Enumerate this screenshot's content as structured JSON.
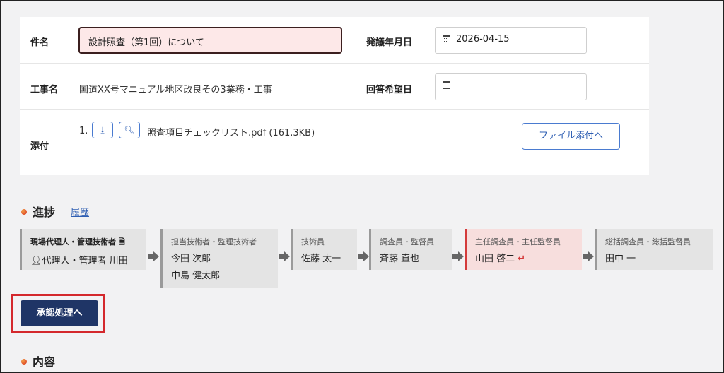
{
  "form": {
    "subject_label": "件名",
    "subject_value": "設計照査（第1回）について",
    "issue_date_label": "発議年月日",
    "issue_date_value": "2026-04-15",
    "project_label": "工事名",
    "project_value": "国道XX号マニュアル地区改良その3業務・工事",
    "reply_date_label": "回答希望日",
    "reply_date_value": "",
    "attachment_label": "添付",
    "attachment_index": "1.",
    "attachment_file": "照査項目チェックリスト.pdf (161.3KB)",
    "attach_button_label": "ファイル添付へ"
  },
  "progress": {
    "title": "進捗",
    "history_link": "履歴",
    "steps": [
      {
        "role": "現場代理人・管理技術者",
        "names": [
          "代理人・管理者 川田"
        ],
        "active": false
      },
      {
        "role": "担当技術者・監理技術者",
        "names": [
          "今田 次郎",
          "中島 健太郎"
        ],
        "active": false
      },
      {
        "role": "技術員",
        "names": [
          "佐藤 太一"
        ],
        "active": false
      },
      {
        "role": "調査員・監督員",
        "names": [
          "斉藤 直也"
        ],
        "active": false
      },
      {
        "role": "主任調査員・主任監督員",
        "names": [
          "山田 啓二"
        ],
        "active": true
      },
      {
        "role": "総括調査員・総括監督員",
        "names": [
          "田中 一"
        ],
        "active": false
      }
    ],
    "return_icon": "return-arrow-icon",
    "active_color": "#d43b3b"
  },
  "approve_button_label": "承認処理へ",
  "content_section_title": "内容",
  "colors": {
    "primary": "#1f3566",
    "link": "#2f5fb3",
    "highlight": "#d4282c"
  }
}
